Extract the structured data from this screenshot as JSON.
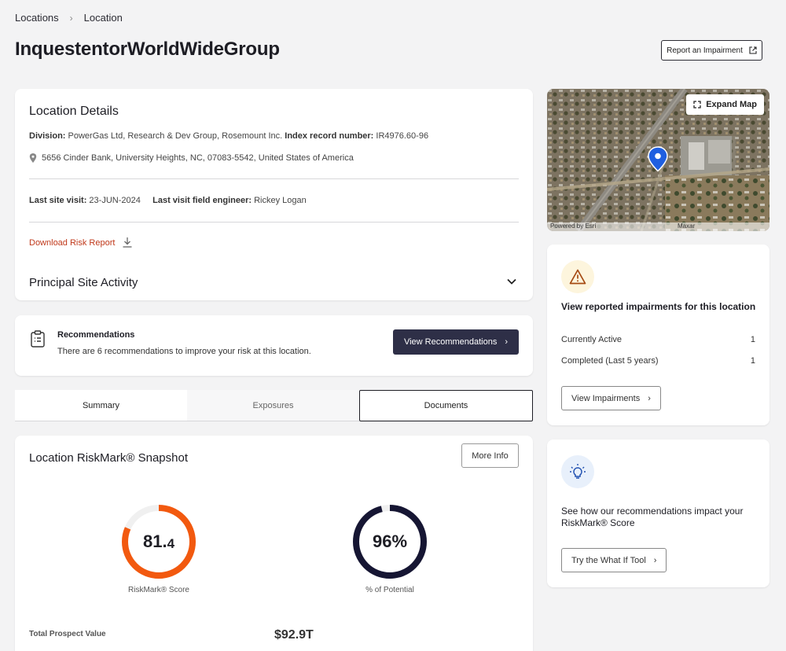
{
  "breadcrumb": {
    "root": "Locations",
    "current": "Location"
  },
  "page_title": "InquestentorWorldWideGroup",
  "report_button": "Report an Impairment",
  "details": {
    "title": "Location Details",
    "division_label": "Division:",
    "division_value": "PowerGas Ltd, Research & Dev Group, Rosemount Inc.",
    "index_label": "Index record number:",
    "index_value": "IR4976.60-96",
    "address": "5656 Cinder Bank, University Heights, NC, 07083-5542, United States of America",
    "last_visit_label": "Last site visit:",
    "last_visit_value": "23-JUN-2024",
    "engineer_label": "Last visit field engineer:",
    "engineer_value": "Rickey Logan",
    "download_label": "Download Risk Report",
    "principal_activity": "Principal Site Activity"
  },
  "recommendations": {
    "title": "Recommendations",
    "text": "There are 6 recommendations to improve your risk at this location.",
    "button": "View Recommendations"
  },
  "tabs": [
    {
      "label": "Summary"
    },
    {
      "label": "Exposures"
    },
    {
      "label": "Documents"
    }
  ],
  "snapshot": {
    "title": "Location RiskMark® Snapshot",
    "more_info": "More Info",
    "riskmark_score_int": "81.",
    "riskmark_score_dec": "4",
    "riskmark_score": 81.4,
    "riskmark_label": "RiskMark® Score",
    "potential_value": "96%",
    "potential": 96,
    "potential_label": "% of Potential",
    "total_prospect_label": "Total Prospect Value",
    "total_prospect_value": "$92.9T"
  },
  "map": {
    "expand": "Expand Map",
    "powered_by": "Powered by Esri",
    "source": "Maxar"
  },
  "impairments": {
    "title": "View reported impairments for this location",
    "rows": [
      {
        "label": "Currently Active",
        "value": "1"
      },
      {
        "label": "Completed (Last 5 years)",
        "value": "1"
      }
    ],
    "button": "View Impairments"
  },
  "whatif": {
    "title": "See how our recommendations impact your RiskMark® Score",
    "button": "Try the What If Tool"
  },
  "colors": {
    "accent_dark": "#2e2f47",
    "risk_orange": "#f2590f",
    "download_red": "#c0391b",
    "potential_navy": "#161633"
  }
}
